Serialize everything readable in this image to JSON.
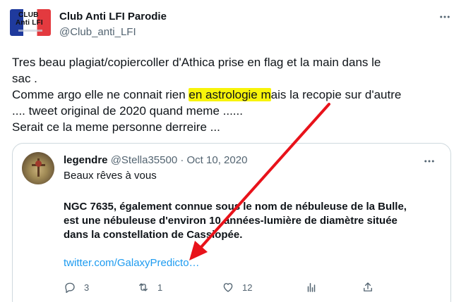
{
  "author": {
    "display_name": "Club Anti LFI Parodie",
    "handle": "@Club_anti_LFI",
    "avatar_text": [
      "CLUB",
      "Anti LFI"
    ]
  },
  "tweet": {
    "line1": "Tres beau plagiat/copiercoller d'Athica prise en flag et  la main dans le",
    "line2": "sac .",
    "line3_before": "Comme argo elle ne connait rien ",
    "line3_highlight": "en astrologie m",
    "line3_after": "ais la recopie sur d'autre",
    "line4": ".... tweet original de 2020 quand meme ......",
    "line5": "Serait ce la meme personne derreire ..."
  },
  "quoted": {
    "name": "legendre",
    "handle": "@Stella35500",
    "separator": "·",
    "date": "Oct 10, 2020",
    "subtitle": "Beaux rêves à vous",
    "body": [
      "NGC 7635, également connue sous le nom de nébuleuse de la Bulle,",
      "est une nébuleuse d'environ 10 années-lumière de diamètre située",
      "dans la constellation de Cassiopée."
    ],
    "link": "twitter.com/GalaxyPredicto…",
    "replies": "3",
    "retweets": "1",
    "likes": "12"
  },
  "annotation": {
    "highlight_color": "#f8f40a",
    "arrow_color": "#e8121a"
  },
  "icons": {
    "more": "more-horizontal-icon",
    "reply": "reply-icon",
    "retweet": "retweet-icon",
    "like": "heart-icon",
    "views": "analytics-icon",
    "share": "share-icon"
  }
}
